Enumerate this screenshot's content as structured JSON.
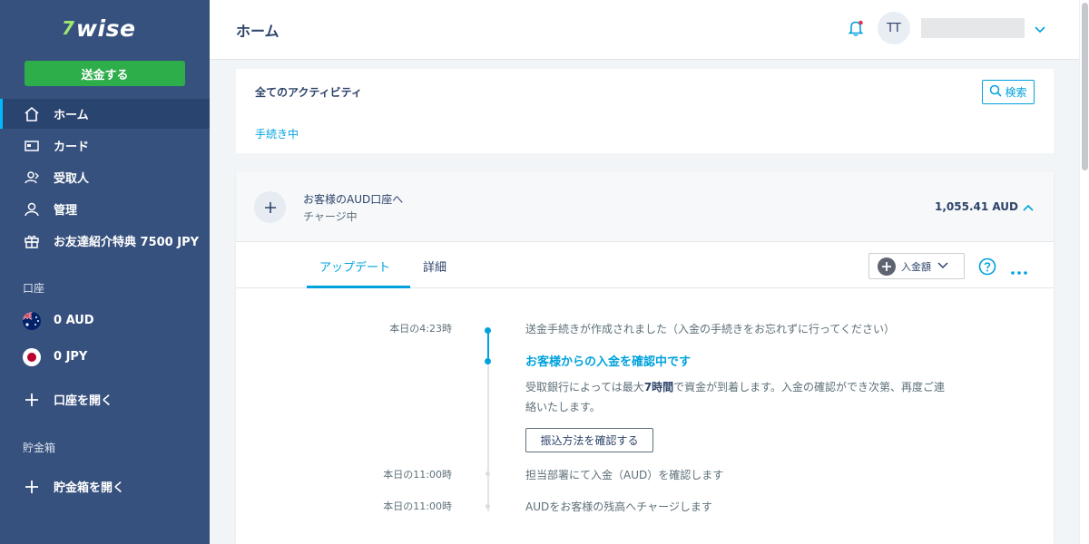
{
  "brand": {
    "name": "wise",
    "mark": "7"
  },
  "sidebar": {
    "send_button": "送金する",
    "nav": [
      {
        "label": "ホーム",
        "icon": "home-icon",
        "active": true
      },
      {
        "label": "カード",
        "icon": "card-icon"
      },
      {
        "label": "受取人",
        "icon": "recipients-icon"
      },
      {
        "label": "管理",
        "icon": "person-icon"
      },
      {
        "label": "お友達紹介特典 7500 JPY",
        "icon": "gift-icon"
      }
    ],
    "accounts_label": "口座",
    "accounts": [
      {
        "label": "0 AUD",
        "flag": "australia-flag-icon"
      },
      {
        "label": "0 JPY",
        "flag": "japan-flag-icon"
      }
    ],
    "open_account": "口座を開く",
    "jars_label": "貯金箱",
    "open_jar": "貯金箱を開く"
  },
  "header": {
    "title": "ホーム",
    "avatar_initials": "TT"
  },
  "activity": {
    "title": "全てのアクティビティ",
    "search_label": "検索",
    "filter_label": "手続き中"
  },
  "transfer": {
    "title": "お客様のAUD口座へ",
    "status": "チャージ中",
    "amount": "1,055.41 AUD",
    "tabs": {
      "updates": "アップデート",
      "details": "詳細"
    },
    "amount_dropdown": "入金額",
    "timeline": [
      {
        "time": "本日の4:23時",
        "text": "送金手続きが作成されました（入金の手続きをお忘れずに行ってください）"
      },
      {
        "heading": "お客様からの入金を確認中です",
        "desc_pre": "受取銀行によっては最大",
        "desc_bold": "7時間",
        "desc_post": "で資金が到着します。入金の確認ができ次第、再度ご連絡いたします。",
        "button": "振込方法を確認する"
      },
      {
        "time": "本日の11:00時",
        "text": "担当部署にて入金（AUD）を確認します"
      },
      {
        "time": "本日の11:00時",
        "text": "AUDをお客様の残高へチャージします"
      }
    ]
  },
  "colors": {
    "sidebar": "#37517e",
    "accent": "#00a2dd",
    "send": "#2ead4b",
    "brand_mark": "#9fe870"
  }
}
